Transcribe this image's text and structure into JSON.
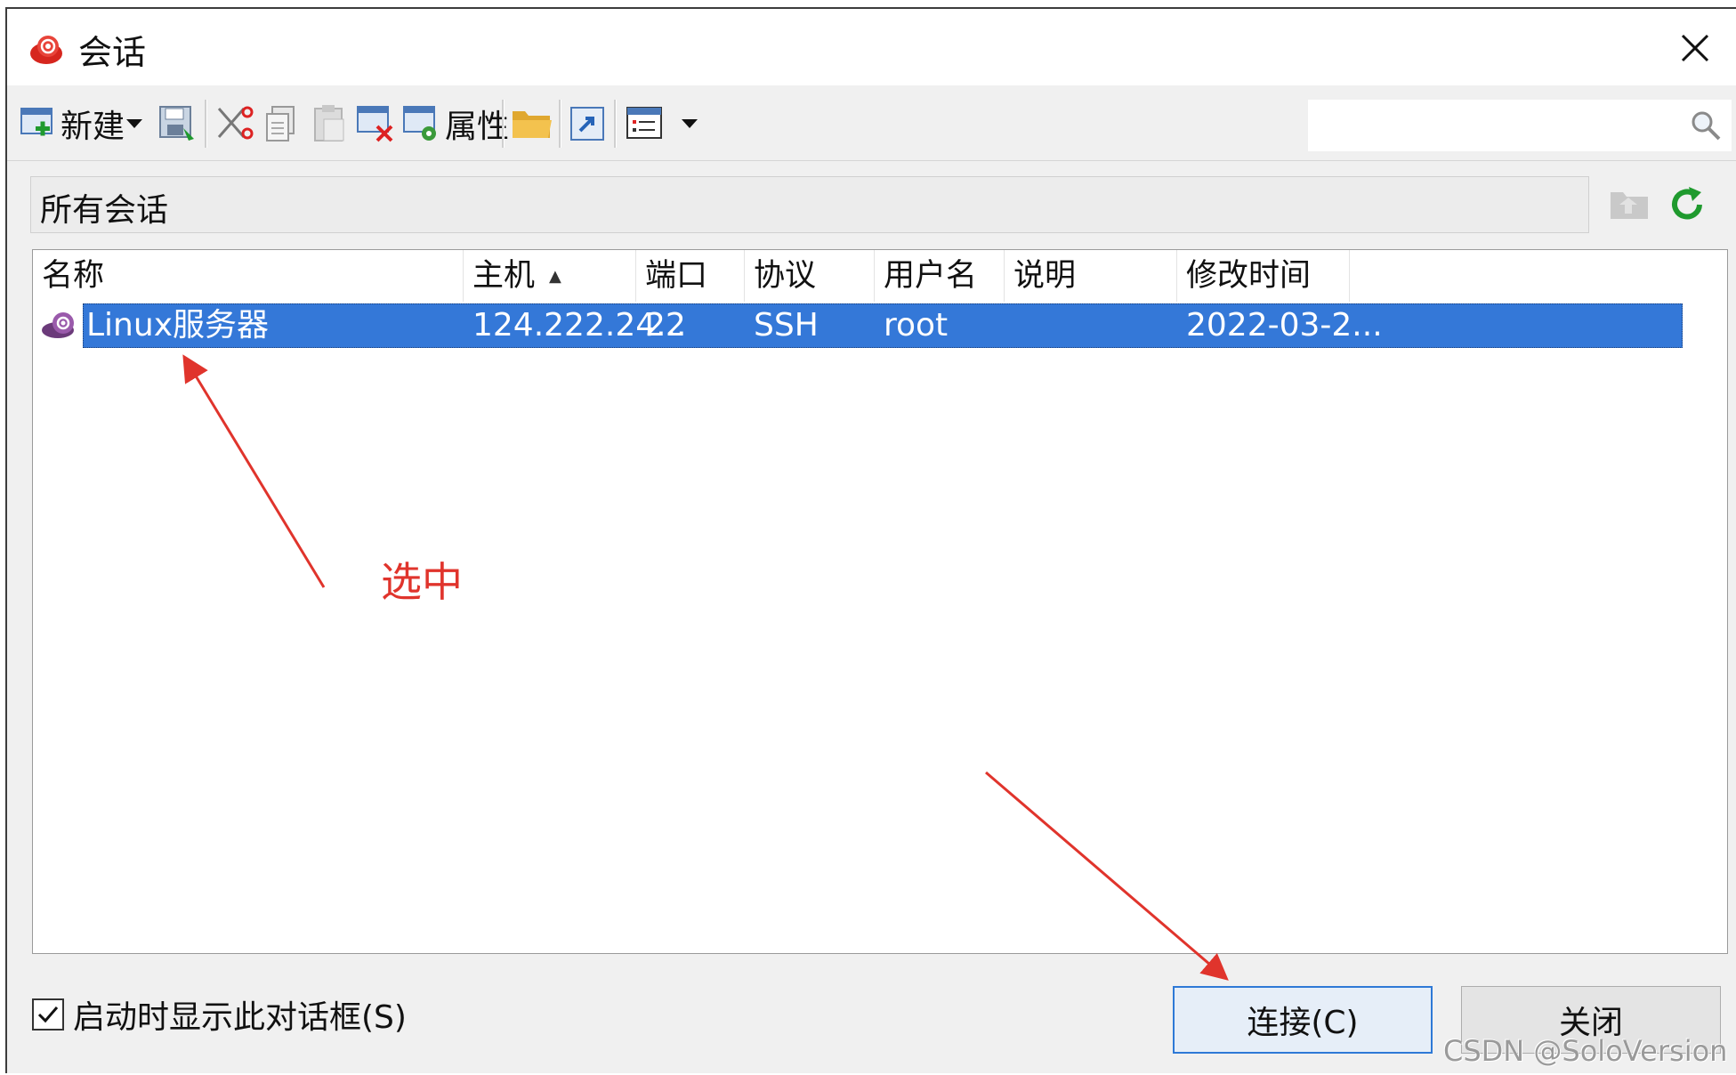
{
  "window": {
    "title": "会话",
    "close_glyph": "✕"
  },
  "toolbar": {
    "new_label": "新建",
    "properties_label": "属性",
    "search_placeholder": ""
  },
  "path_bar": {
    "text": "所有会话"
  },
  "table": {
    "columns": [
      "名称",
      "主机",
      "端口",
      "协议",
      "用户名",
      "说明",
      "修改时间"
    ],
    "sort_indicator": "▲",
    "rows": [
      {
        "name": "Linux服务器",
        "host": "124.222.24...",
        "port": "22",
        "protocol": "SSH",
        "username": "root",
        "description": "",
        "modified": "2022-03-2..."
      }
    ]
  },
  "annotation": {
    "label": "选中",
    "color": "#e0342c"
  },
  "footer": {
    "checkbox_label": "启动时显示此对话框(S)",
    "checkbox_checked": true,
    "connect_label": "连接(C)",
    "close_label": "关闭"
  },
  "watermark": "CSDN @SoloVersion",
  "colors": {
    "selection": "#3478d8",
    "accent": "#2e79d6"
  }
}
